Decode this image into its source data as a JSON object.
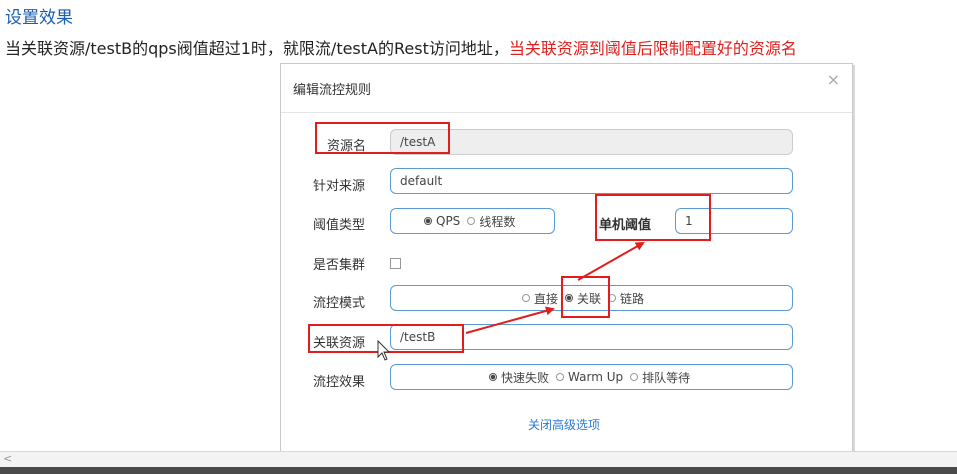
{
  "heading": "设置效果",
  "description": {
    "main": "当关联资源/testB的qps阀值超过1时，就限流/testA的Rest访问地址，",
    "highlight": "当关联资源到阈值后限制配置好的资源名"
  },
  "dialog": {
    "title": "编辑流控规则",
    "close": "×",
    "resource_name": {
      "label": "资源名",
      "value": "/testA"
    },
    "limit_app": {
      "label": "针对来源",
      "value": "default"
    },
    "threshold_type": {
      "label": "阈值类型",
      "options": [
        "QPS",
        "线程数"
      ],
      "selected": "QPS"
    },
    "single_threshold": {
      "label": "单机阈值",
      "value": "1"
    },
    "cluster": {
      "label": "是否集群",
      "checked": false
    },
    "control_mode": {
      "label": "流控模式",
      "options": [
        "直接",
        "关联",
        "链路"
      ],
      "selected": "关联"
    },
    "related_resource": {
      "label": "关联资源",
      "value": "/testB"
    },
    "control_effect": {
      "label": "流控效果",
      "options": [
        "快速失败",
        "Warm Up",
        "排队等待"
      ],
      "selected": "快速失败"
    },
    "advanced_toggle": "关闭高级选项"
  },
  "scrollbar": {
    "left_arrow": "<"
  },
  "colors": {
    "annotation": "#e01e1e",
    "accent": "#5b9bd5",
    "link": "#2b7bd1",
    "heading": "#1a5fb4"
  }
}
